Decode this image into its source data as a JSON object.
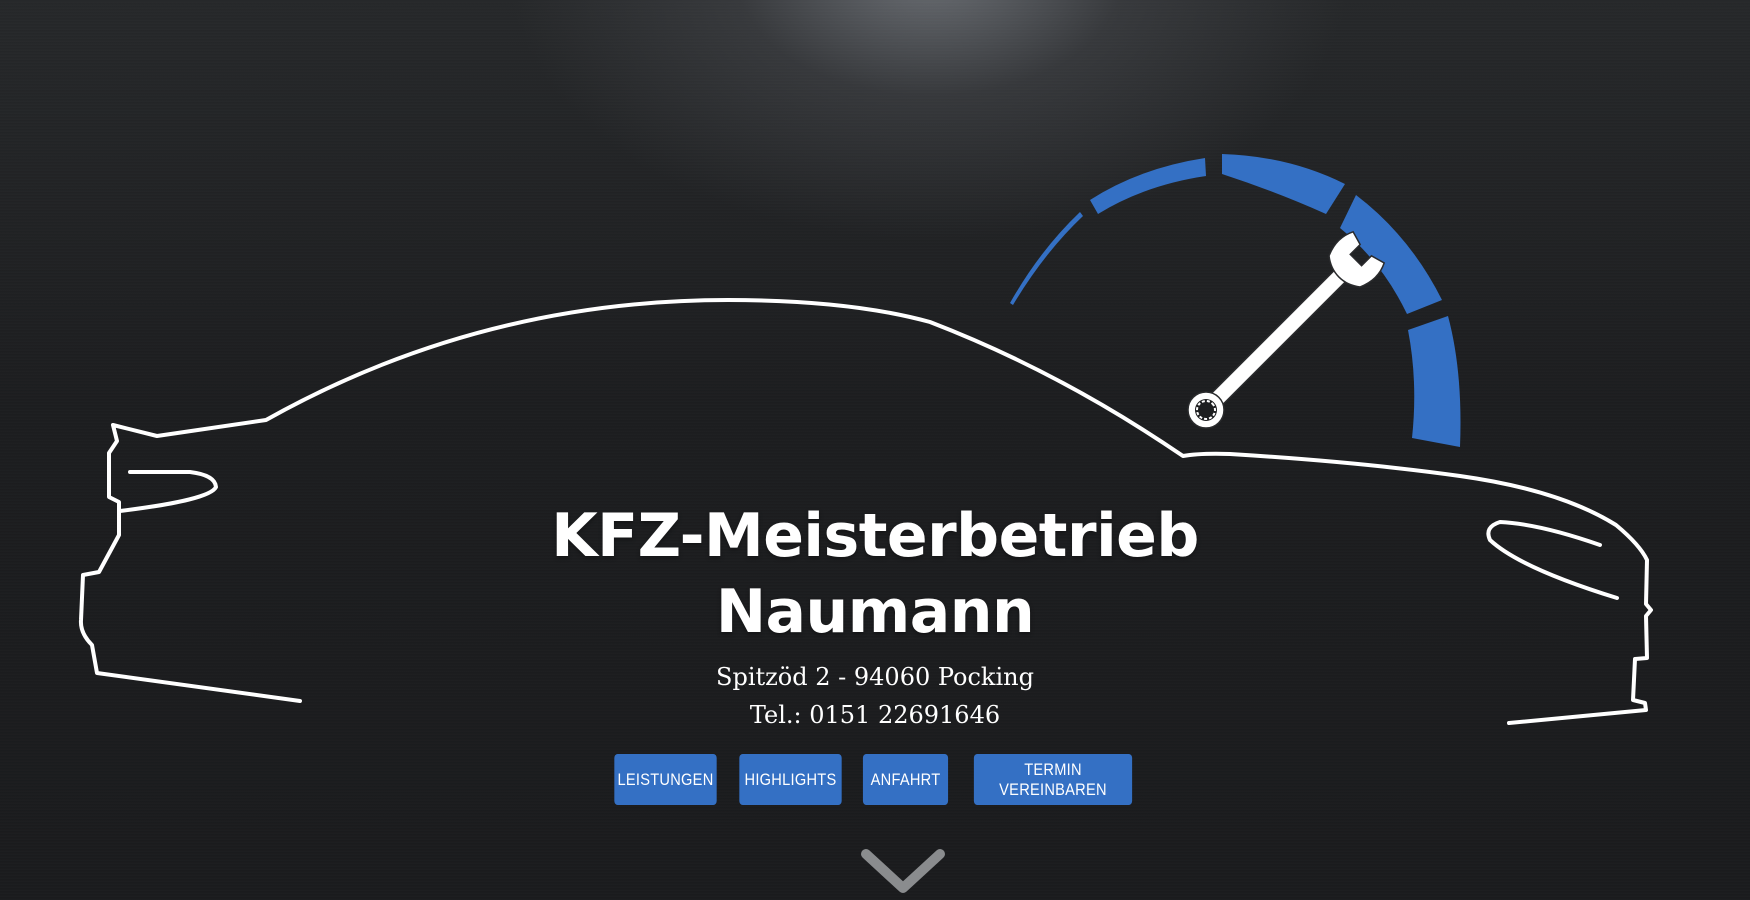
{
  "title": {
    "line1": "KFZ-Meisterbetrieb",
    "line2": "Naumann"
  },
  "address": "Spitzöd 2 - 94060 Pocking",
  "phone": "Tel.: 0151 22691646",
  "nav": {
    "leistungen": "Leistungen",
    "highlights": "Highlights",
    "anfahrt": "Anfahrt",
    "termin": "Termin vereinbaren"
  },
  "icons": {
    "logo_car": "car-outline",
    "logo_gauge": "gauge-arc",
    "logo_wrench": "wrench",
    "scroll": "chevron-down-icon"
  },
  "colors": {
    "accent": "#3470c4",
    "text": "#ffffff",
    "background": "#1d1e20",
    "chevron": "#8a8c8e"
  }
}
